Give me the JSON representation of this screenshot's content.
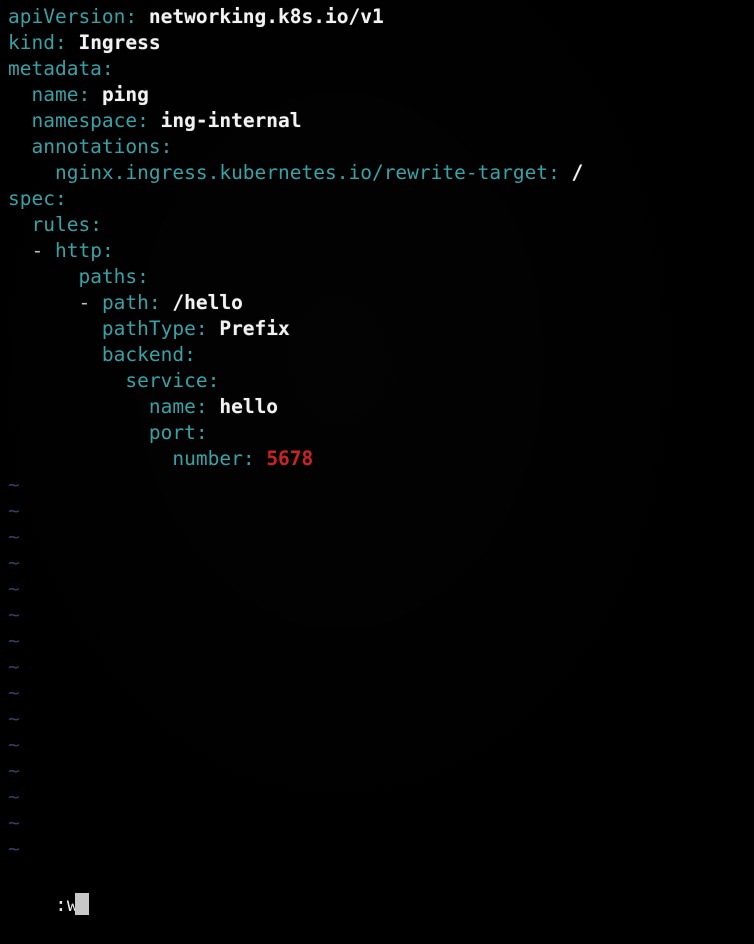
{
  "terminal": {
    "app": "vim",
    "mode": "command",
    "background_color": "#000000",
    "colors": {
      "key": "#36a2a6",
      "value": "#f2f2f2",
      "number": "#cc2020",
      "tilde": "#2e3f66",
      "cursor": "#c8c8c8",
      "command_text": "#e8e8e8"
    }
  },
  "buffer": {
    "filetype": "yaml",
    "lines": [
      {
        "indent": "",
        "key": "apiVersion",
        "sep": ": ",
        "value": "networking.k8s.io/v1",
        "kind": "value"
      },
      {
        "indent": "",
        "key": "kind",
        "sep": ": ",
        "value": "Ingress",
        "kind": "value"
      },
      {
        "indent": "",
        "key": "metadata",
        "sep": ":",
        "value": "",
        "kind": "mapping"
      },
      {
        "indent": "  ",
        "key": "name",
        "sep": ": ",
        "value": "ping",
        "kind": "value"
      },
      {
        "indent": "  ",
        "key": "namespace",
        "sep": ": ",
        "value": "ing-internal",
        "kind": "value"
      },
      {
        "indent": "  ",
        "key": "annotations",
        "sep": ":",
        "value": "",
        "kind": "mapping"
      },
      {
        "indent": "    ",
        "key": "nginx.ingress.kubernetes.io/rewrite-target",
        "sep": ": ",
        "value": "/",
        "kind": "value"
      },
      {
        "indent": "",
        "key": "spec",
        "sep": ":",
        "value": "",
        "kind": "mapping"
      },
      {
        "indent": "  ",
        "key": "rules",
        "sep": ":",
        "value": "",
        "kind": "mapping"
      },
      {
        "indent": "  ",
        "dash": "- ",
        "key": "http",
        "sep": ":",
        "value": "",
        "kind": "seq-mapping"
      },
      {
        "indent": "      ",
        "key": "paths",
        "sep": ":",
        "value": "",
        "kind": "mapping"
      },
      {
        "indent": "      ",
        "dash": "- ",
        "key": "path",
        "sep": ": ",
        "value": "/hello",
        "kind": "seq-value"
      },
      {
        "indent": "        ",
        "key": "pathType",
        "sep": ": ",
        "value": "Prefix",
        "kind": "value"
      },
      {
        "indent": "        ",
        "key": "backend",
        "sep": ":",
        "value": "",
        "kind": "mapping"
      },
      {
        "indent": "          ",
        "key": "service",
        "sep": ":",
        "value": "",
        "kind": "mapping"
      },
      {
        "indent": "            ",
        "key": "name",
        "sep": ": ",
        "value": "hello",
        "kind": "value"
      },
      {
        "indent": "            ",
        "key": "port",
        "sep": ":",
        "value": "",
        "kind": "mapping"
      },
      {
        "indent": "              ",
        "key": "number",
        "sep": ": ",
        "value": "5678",
        "kind": "number"
      }
    ]
  },
  "filler": {
    "glyph": "~",
    "count": 15
  },
  "command_line": {
    "text": ":wq",
    "cursor_char": "q",
    "cursor_visible": true
  }
}
